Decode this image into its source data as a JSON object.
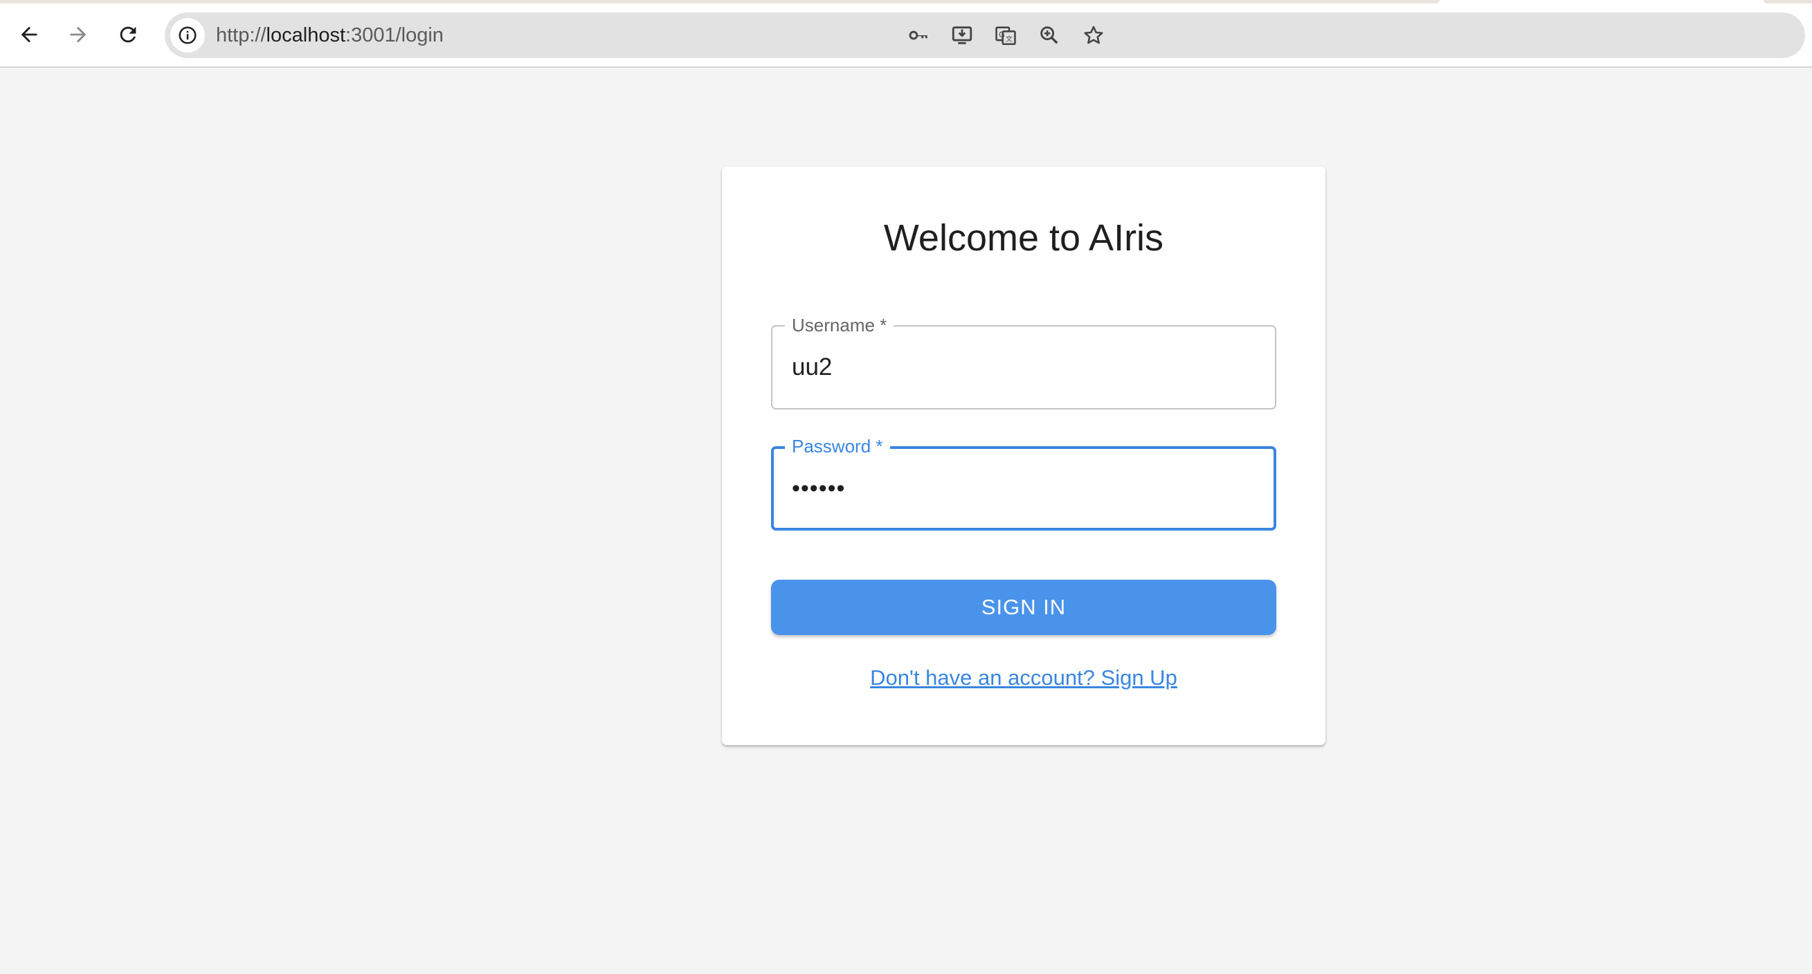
{
  "browser": {
    "url_scheme": "http://",
    "url_host": "localhost",
    "url_rest": ":3001/login",
    "icons": {
      "back": "back-arrow-icon",
      "forward": "forward-arrow-icon",
      "reload": "reload-icon",
      "site_info": "info-icon",
      "passwords": "key-icon",
      "install": "install-app-icon",
      "translate": "translate-icon",
      "zoom": "zoom-icon",
      "bookmark": "star-icon"
    }
  },
  "login": {
    "title": "Welcome to AIris",
    "username_label": "Username *",
    "username_value": "uu2",
    "password_label": "Password *",
    "password_value": "••••••",
    "submit_label": "SIGN IN",
    "signup_link": "Don't have an account? Sign Up"
  },
  "colors": {
    "accent": "#3a86e0",
    "button": "#4a93ea",
    "background": "#f4f4f4"
  }
}
